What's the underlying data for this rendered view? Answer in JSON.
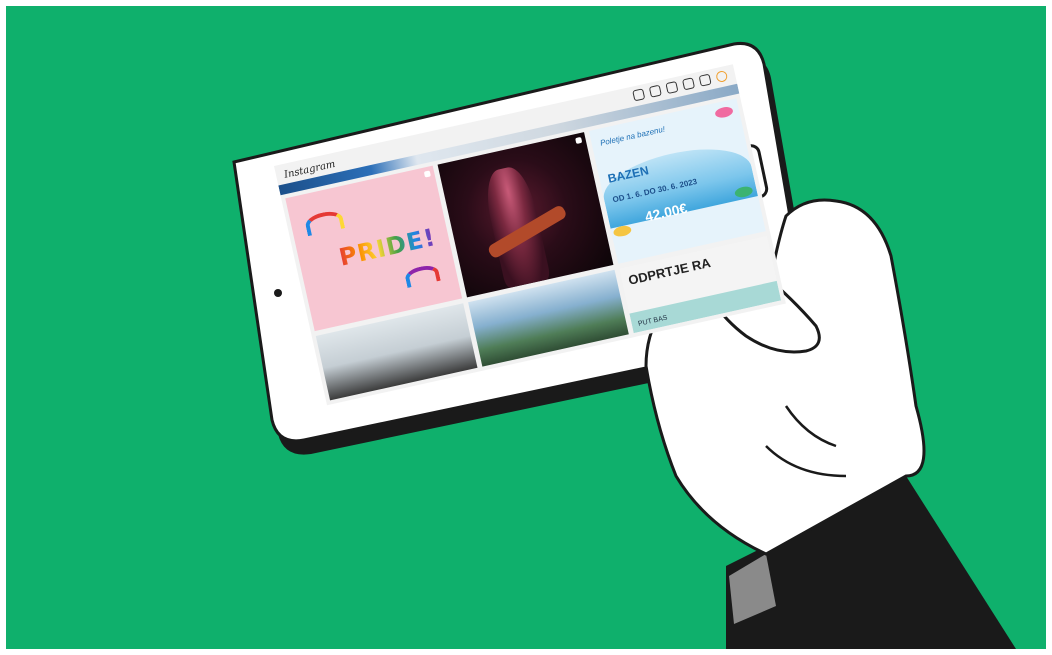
{
  "scene": {
    "background_color": "#0fb06c",
    "description_objects": [
      "tablet-device",
      "hand",
      "sleeve"
    ]
  },
  "app": {
    "logo_text": "Instagram",
    "top_icons": [
      "home-icon",
      "send-icon",
      "add-icon",
      "explore-icon",
      "heart-icon",
      "profile-icon"
    ]
  },
  "posts": [
    {
      "kind": "pride",
      "text": "PRIDE!"
    },
    {
      "kind": "concert"
    },
    {
      "kind": "pool",
      "small": "Poletje na bazenu!",
      "title": "BAZEN",
      "dates": "OD 1. 6. DO 30. 6. 2023",
      "price": "42.00€"
    },
    {
      "kind": "crowd"
    },
    {
      "kind": "stadium"
    },
    {
      "kind": "open",
      "title": "ODPRTJE RA",
      "sub": "PUT BAS"
    }
  ]
}
